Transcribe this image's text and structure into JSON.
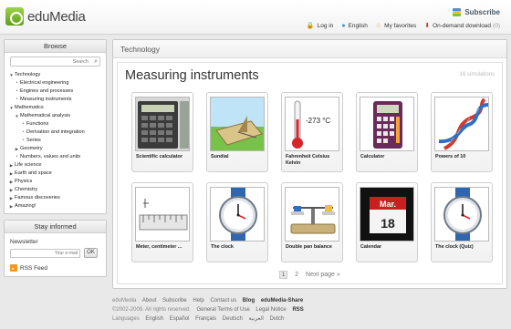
{
  "header": {
    "logo_text": "eduMedia",
    "subscribe_label": "Subscribe",
    "links": [
      {
        "icon": "login-icon",
        "label": "Log in"
      },
      {
        "icon": "globe-icon",
        "label": "English"
      },
      {
        "icon": "star-icon",
        "label": "My favorites"
      },
      {
        "icon": "download-icon",
        "label": "On-demand download",
        "count": "(0)"
      }
    ]
  },
  "sidebar": {
    "browse_title": "Browse",
    "search_placeholder": "Search",
    "tree": [
      {
        "label": "Technology",
        "level": 1,
        "marker": "open"
      },
      {
        "label": "Electrical engineering",
        "level": 2,
        "marker": "dot"
      },
      {
        "label": "Engines and processes",
        "level": 2,
        "marker": "dot"
      },
      {
        "label": "Measuring instruments",
        "level": 2,
        "marker": "dot"
      },
      {
        "label": "Mathematics",
        "level": 1,
        "marker": "open"
      },
      {
        "label": "Mathematical analysis",
        "level": 2,
        "marker": "open"
      },
      {
        "label": "Functions",
        "level": 3,
        "marker": "dot"
      },
      {
        "label": "Derivation and integration",
        "level": 3,
        "marker": "dot"
      },
      {
        "label": "Series",
        "level": 3,
        "marker": "dot"
      },
      {
        "label": "Geometry",
        "level": 2,
        "marker": "closed"
      },
      {
        "label": "Numbers, values and units",
        "level": 2,
        "marker": "dot"
      },
      {
        "label": "Life science",
        "level": 1,
        "marker": "closed"
      },
      {
        "label": "Earth and space",
        "level": 1,
        "marker": "closed"
      },
      {
        "label": "Physics",
        "level": 1,
        "marker": "closed"
      },
      {
        "label": "Chemistry",
        "level": 1,
        "marker": "closed"
      },
      {
        "label": "Famous discoveries",
        "level": 1,
        "marker": "closed"
      },
      {
        "label": "Amazing!",
        "level": 1,
        "marker": "closed"
      }
    ],
    "stay_title": "Stay informed",
    "newsletter_label": "Newsletter",
    "email_placeholder": "Your e-mail",
    "ok_label": "OK",
    "rss_label": "RSS Feed"
  },
  "main": {
    "breadcrumb": "Technology",
    "title": "Measuring instruments",
    "sim_count": "16 simulations",
    "cards": [
      {
        "label": "Scientific calculator",
        "icon": "scientific-calculator"
      },
      {
        "label": "Sundial",
        "icon": "sundial"
      },
      {
        "label": "Fahrenheit Celsius Kelvin",
        "icon": "thermometer"
      },
      {
        "label": "Calculator",
        "icon": "calculator"
      },
      {
        "label": "Powers of 10",
        "icon": "dna-helix"
      },
      {
        "label": "Meter, centimeter ...",
        "icon": "ruler"
      },
      {
        "label": "The clock",
        "icon": "clock"
      },
      {
        "label": "Double pan balance",
        "icon": "balance"
      },
      {
        "label": "Calendar",
        "icon": "calendar"
      },
      {
        "label": "The clock (Quiz)",
        "icon": "clock"
      }
    ],
    "thermo_text": "-273 °C",
    "calendar_month": "Mar.",
    "calendar_day": "18",
    "pager": {
      "current": "1",
      "next_page": "2",
      "next_label": "Next page »"
    }
  },
  "footer": {
    "links": [
      "eduMedia",
      "About",
      "Subscribe",
      "Help",
      "Contact us",
      "Blog",
      "eduMedia-Share"
    ],
    "copyright": "©2002-2009. All rights reserved.",
    "legal": [
      "General Terms of Use",
      "Legal Notice",
      "RSS"
    ],
    "languages_label": "Languages",
    "languages": [
      "English",
      "Español",
      "Français",
      "Deutsch",
      "العربية",
      "Dutch"
    ]
  }
}
